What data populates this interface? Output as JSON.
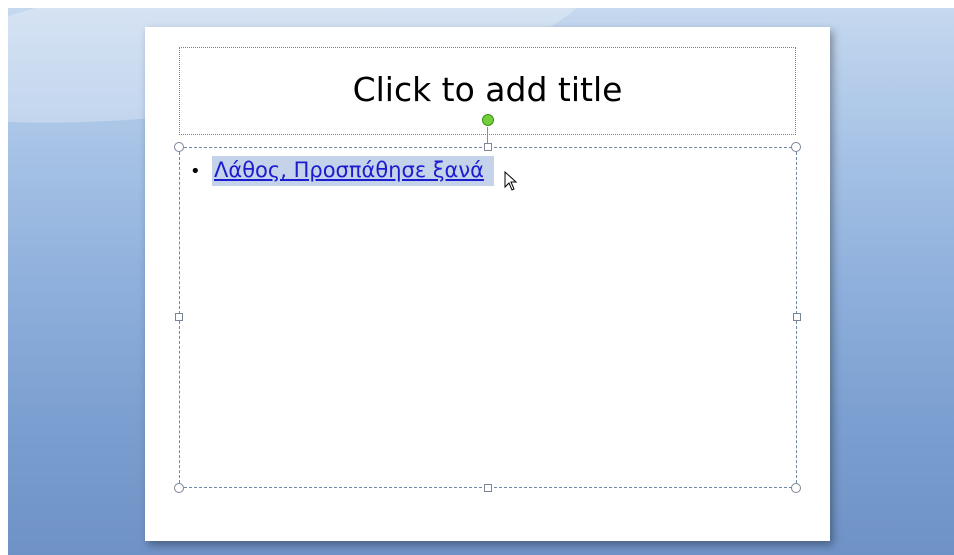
{
  "slide": {
    "title_placeholder": "Click to add title",
    "bullets": [
      {
        "text": "Λάθος, Προσπάθησε ξανά"
      }
    ]
  },
  "icons": {
    "rotate": "rotate-handle-icon",
    "cursor": "arrow-cursor-icon",
    "bullet": "bullet-icon"
  },
  "colors": {
    "link": "#1b1bd0",
    "selection": "#c4d3ea",
    "rotate_handle": "#6fd038"
  }
}
